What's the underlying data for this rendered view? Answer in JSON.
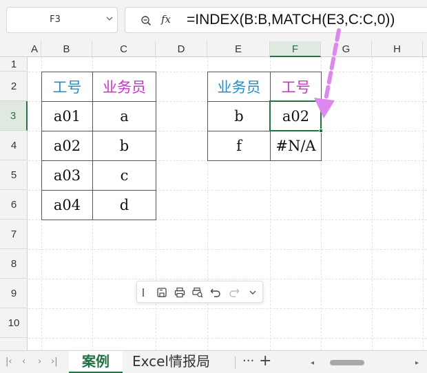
{
  "formula_bar": {
    "name_box": "F3",
    "formula": "=INDEX(B:B,MATCH(E3,C:C,0))"
  },
  "columns": [
    "A",
    "B",
    "C",
    "D",
    "E",
    "F",
    "G",
    "H"
  ],
  "rows": [
    "1",
    "2",
    "3",
    "4",
    "5",
    "6",
    "7",
    "8",
    "9",
    "10"
  ],
  "left_table": {
    "header": [
      "工号",
      "业务员"
    ],
    "rows": [
      [
        "a01",
        "a"
      ],
      [
        "a02",
        "b"
      ],
      [
        "a03",
        "c"
      ],
      [
        "a04",
        "d"
      ]
    ]
  },
  "right_table": {
    "header": [
      "业务员",
      "工号"
    ],
    "rows": [
      [
        "b",
        "a02"
      ],
      [
        "f",
        "#N/A"
      ]
    ]
  },
  "sheet_tabs": {
    "active": "案例",
    "other": "Excel情报局",
    "more": "···",
    "add": "+"
  },
  "colors": {
    "header_blue": "#1f8fc7",
    "header_pink": "#cc33cc",
    "selection_green": "#217346",
    "arrow": "#dd88ee"
  }
}
